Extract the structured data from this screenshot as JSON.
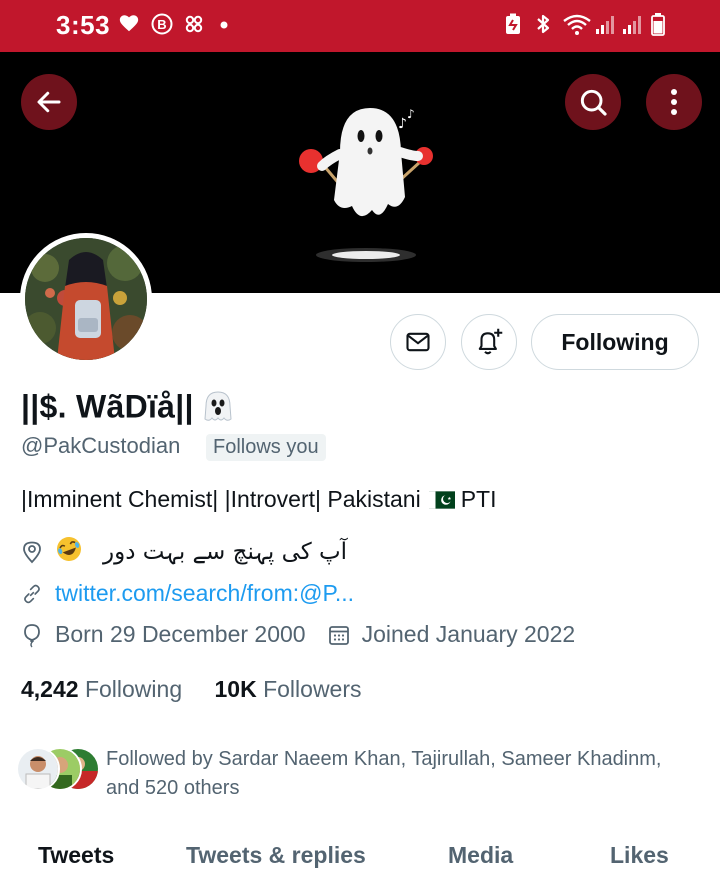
{
  "status_bar": {
    "time": "3:53",
    "icons": [
      "heart-icon",
      "b-badge-icon",
      "pinwheel-icon",
      "dot-icon",
      "battery-saver-icon",
      "bluetooth-icon",
      "wifi-icon",
      "signal-icon",
      "signal-icon",
      "battery-icon"
    ],
    "background": "#c1172c"
  },
  "header": {
    "back_icon": "arrow-left-icon",
    "search_icon": "search-icon",
    "more_icon": "more-vertical-icon"
  },
  "profile": {
    "display_name": "||$. WãDïå||",
    "handle": "@PakCustodian",
    "follows_you": "Follows you",
    "bio_text": "|Imminent Chemist| |Introvert|  Pakistani",
    "bio_tag": "PTI",
    "location": "آپ کی پہنچ سے بہت دور",
    "website": "twitter.com/search/from:@P...",
    "birthday": "Born 29 December 2000",
    "joined": "Joined January 2022"
  },
  "actions": {
    "following_label": "Following",
    "message_icon": "envelope-icon",
    "notify_icon": "bell-plus-icon"
  },
  "counts": {
    "following_num": "4,242",
    "following_label": "Following",
    "followers_num": "10K",
    "followers_label": "Followers"
  },
  "followed_by": {
    "text": "Followed by Sardar Naeem Khan, Tajirullah, Sameer Khadinm, and 520 others"
  },
  "tabs": [
    {
      "label": "Tweets",
      "active": true
    },
    {
      "label": "Tweets & replies",
      "active": false
    },
    {
      "label": "Media",
      "active": false
    },
    {
      "label": "Likes",
      "active": false
    }
  ],
  "colors": {
    "accent": "#1d9bf0",
    "muted": "#536471",
    "text": "#0f1419"
  }
}
